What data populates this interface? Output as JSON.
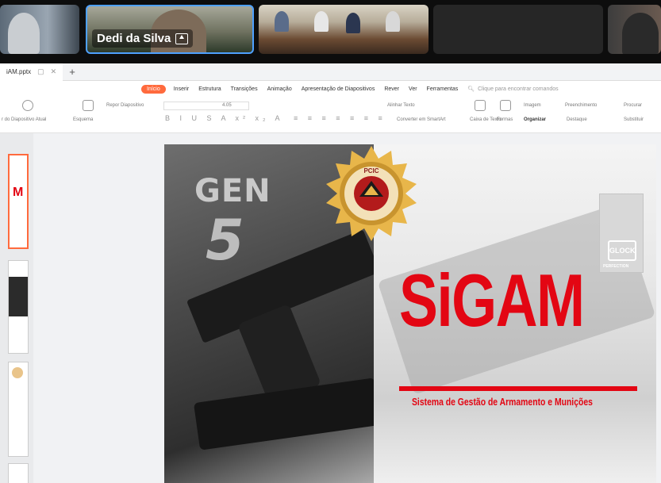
{
  "participants": [
    {
      "name": ""
    },
    {
      "name": "Dedi da Silva"
    },
    {
      "name": ""
    },
    {
      "name": ""
    },
    {
      "name": ""
    }
  ],
  "file_tab": {
    "label": "iAM.pptx"
  },
  "menu": {
    "items": [
      "Início",
      "Inserir",
      "Estrutura",
      "Transições",
      "Animação",
      "Apresentação de Diapositivos",
      "Rever",
      "Ver",
      "Ferramentas"
    ],
    "search": "Clique para encontrar comandos"
  },
  "ribbon": {
    "from_current": "r do Diapositivo Atual",
    "layout": "Esquema",
    "reset": "Repor Diapositivo",
    "font_size": "4.05",
    "align_text": "Alinhar Texto",
    "convert_smartart": "Converter em SmartArt",
    "text_box": "Caixa de Texto",
    "shapes": "Formas",
    "image": "Imagem",
    "fill": "Preenchimento",
    "arrange": "Organizar",
    "highlight": "Destaque",
    "find": "Procurar",
    "replace": "Substituir"
  },
  "slide": {
    "gen_text": "GEN",
    "gen_number": "5",
    "seal_text": "PCIC",
    "title": "SiGAM",
    "subtitle": "Sistema de Gestão de Armamento e Munições",
    "brand": "GLOCK",
    "brand_tag": "PERFECTION"
  },
  "colors": {
    "accent": "#ff6a3d",
    "brand_red": "#e30613",
    "highlight_border": "#4ea1ff"
  }
}
